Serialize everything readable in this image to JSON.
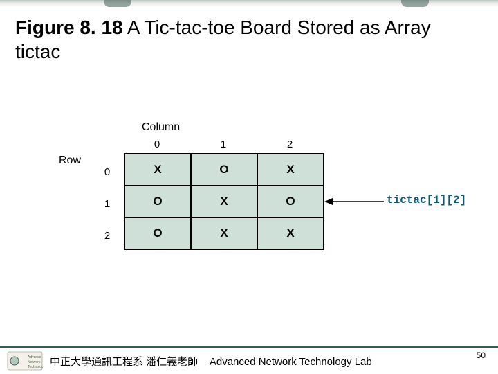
{
  "title": {
    "figure_label": "Figure 8. 18",
    "caption_rest": "  A Tic-tac-toe Board Stored as Array tictac"
  },
  "diagram": {
    "column_label": "Column",
    "row_label": "Row",
    "col_indices": [
      "0",
      "1",
      "2"
    ],
    "row_indices": [
      "0",
      "1",
      "2"
    ],
    "cells": [
      [
        "X",
        "O",
        "X"
      ],
      [
        "O",
        "X",
        "O"
      ],
      [
        "O",
        "X",
        "X"
      ]
    ],
    "annotation": "tictac[1][2]"
  },
  "footer": {
    "text_zh": "中正大學通訊工程系 潘仁義老師",
    "text_en": "Advanced Network Technology Lab"
  },
  "page_number": "50",
  "chart_data": {
    "type": "table",
    "title": "Tic-tac-toe board stored as array tictac",
    "row_labels": [
      0,
      1,
      2
    ],
    "col_labels": [
      0,
      1,
      2
    ],
    "values": [
      [
        "X",
        "O",
        "X"
      ],
      [
        "O",
        "X",
        "O"
      ],
      [
        "O",
        "X",
        "X"
      ]
    ],
    "annotation_target": {
      "row": 1,
      "col": 2,
      "expr": "tictac[1][2]"
    }
  }
}
